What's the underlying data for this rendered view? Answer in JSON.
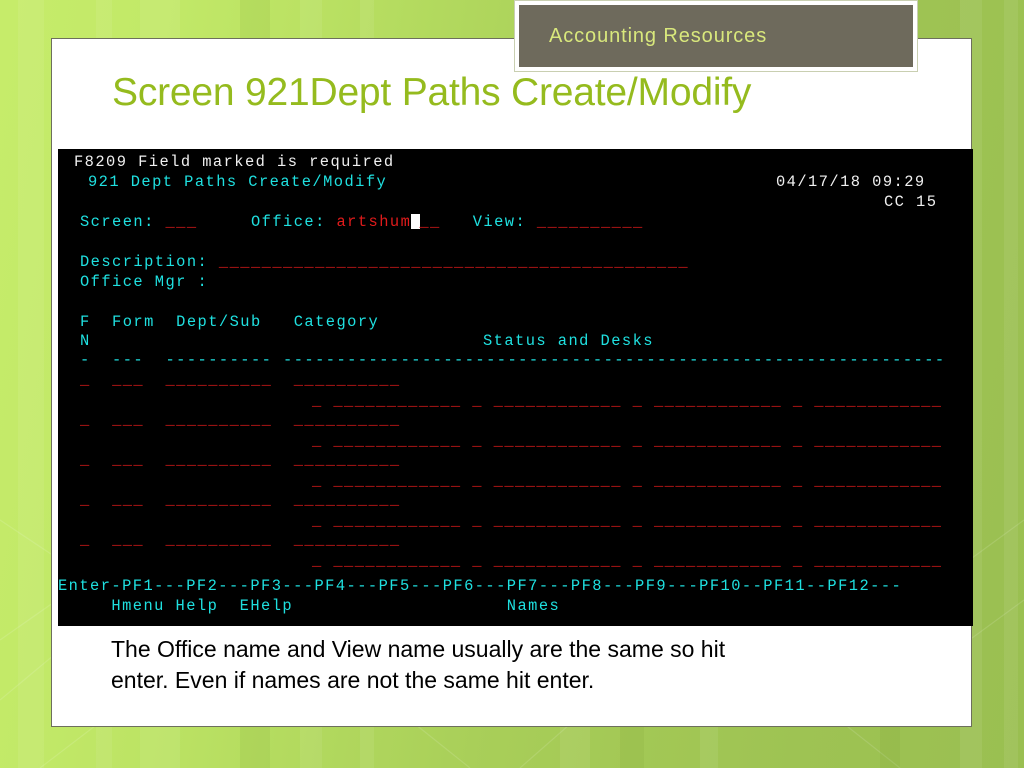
{
  "slide": {
    "banner_label": "Accounting Resources",
    "title": "Screen 921Dept Paths Create/Modify",
    "caption_line1": "The Office name and View name usually are the same so hit",
    "caption_line2": "enter.  Even if names are not the same hit enter.",
    "colors": {
      "background_green": "#a9cf59",
      "title_green": "#95bb1e",
      "banner_gray": "#6e6a5c",
      "banner_text": "#d9e87c",
      "card_white": "#ffffff"
    }
  },
  "terminal": {
    "colors": {
      "background": "#000000",
      "label_cyan": "#1fe0e0",
      "message_white": "#f0f0f0",
      "field_red": "#e01b1b",
      "cursor_white": "#ffffff"
    },
    "message": "F8209 Field marked is required",
    "screen_title": "921 Dept Paths Create/Modify",
    "date": "04/17/18 09:29",
    "terminal_id": "CC 15",
    "fields": {
      "screen_label": "Screen:",
      "screen_value": "___",
      "office_label": "Office:",
      "office_value": "artshum",
      "office_trailing_blank": "__",
      "view_label": "View:",
      "view_value": "__________",
      "description_label": "Description:",
      "description_value": "____________________________________________",
      "office_mgr_label": "Office Mgr :"
    },
    "columns": {
      "row1": "F  Form  Dept/Sub   Category",
      "row2_left": "N",
      "row2_right": "Status and Desks",
      "separator_short": "-  ---  ----------",
      "separator_long": "--------------------------------------------------------------"
    },
    "grid": {
      "primary_row": {
        "fn": "_",
        "form": "___",
        "dept_sub": "__________",
        "category": "__________"
      },
      "status_row": {
        "cells": [
          {
            "flag": "_",
            "desk": "____________"
          },
          {
            "flag": "_",
            "desk": "____________"
          },
          {
            "flag": "_",
            "desk": "____________"
          },
          {
            "flag": "_",
            "desk": "____________"
          }
        ]
      },
      "row_count": 5
    },
    "pf_keys": {
      "bar": "Enter-PF1---PF2---PF3---PF4---PF5---PF6---PF7---PF8---PF9---PF10--PF11--PF12---",
      "labels": "     Hmenu Help  EHelp                    Names"
    }
  }
}
